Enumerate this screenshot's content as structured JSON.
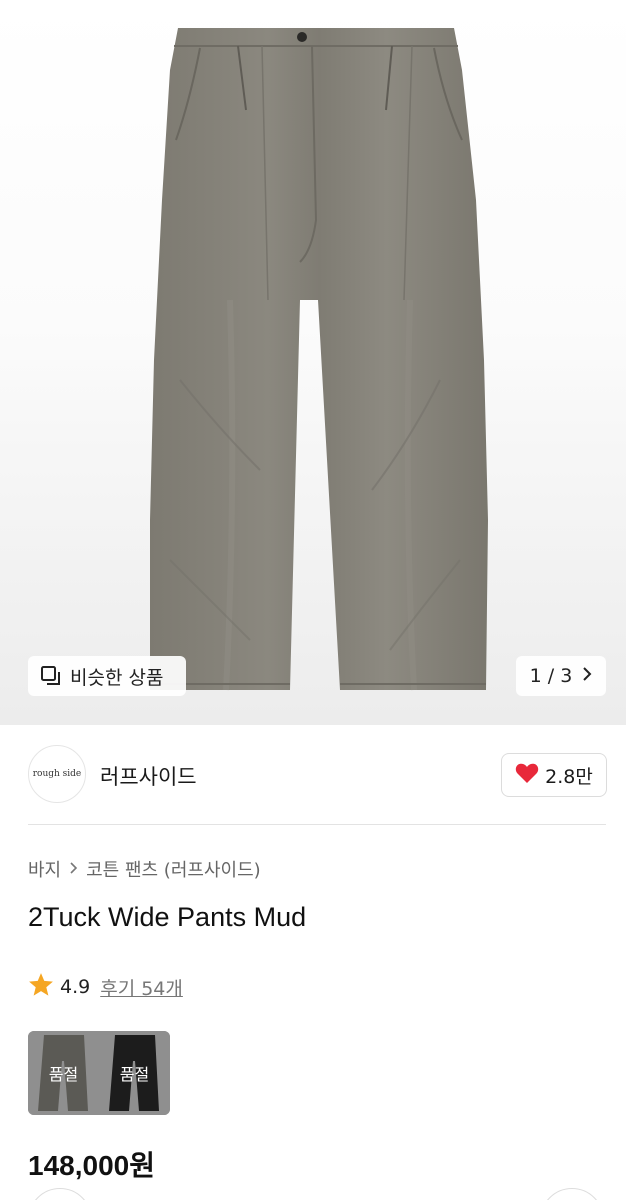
{
  "gallery": {
    "similar_label": "비슷한 상품",
    "current_page": "1",
    "separator": "/",
    "total_pages": "3"
  },
  "shop": {
    "logo_text": "rough side",
    "logo_subtext": "",
    "name": "러프사이드",
    "likes": "2.8만"
  },
  "breadcrumb": {
    "category": "바지",
    "subcategory": "코튼 팬츠 (러프사이드)"
  },
  "product": {
    "title": "2Tuck Wide Pants Mud",
    "rating": "4.9",
    "reviews": "후기 54개",
    "price": "148,000원"
  },
  "options": [
    {
      "status": "품절",
      "color": "#5b5a55"
    },
    {
      "status": "품절",
      "color": "#1c1c1c"
    }
  ],
  "colors": {
    "heart": "#e8283a",
    "star": "#f5a623",
    "pants": "#8a877e"
  }
}
